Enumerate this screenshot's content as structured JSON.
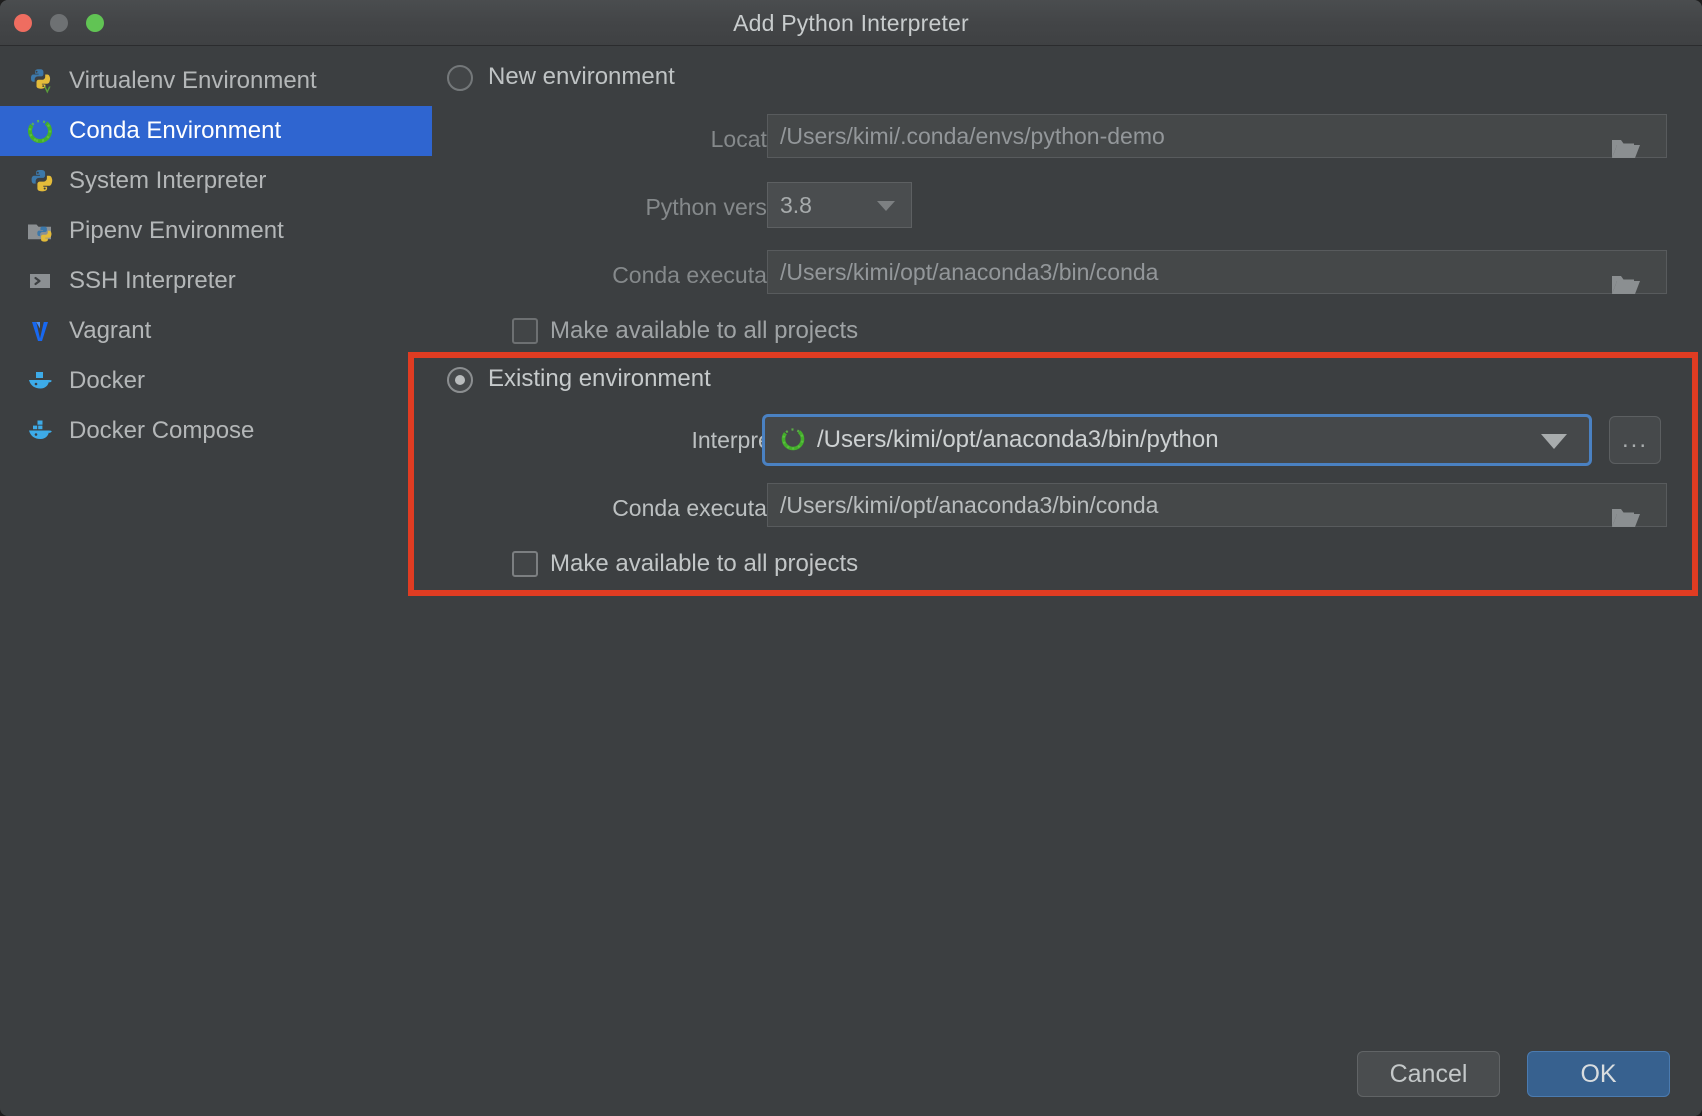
{
  "window": {
    "title": "Add Python Interpreter",
    "traffic_lights": [
      "close",
      "minimize",
      "maximize"
    ]
  },
  "sidebar": {
    "items": [
      {
        "label": "Virtualenv Environment",
        "icon": "python-virtualenv-icon",
        "selected": false
      },
      {
        "label": "Conda Environment",
        "icon": "conda-icon",
        "selected": true
      },
      {
        "label": "System Interpreter",
        "icon": "python-icon",
        "selected": false
      },
      {
        "label": "Pipenv Environment",
        "icon": "pipenv-icon",
        "selected": false
      },
      {
        "label": "SSH Interpreter",
        "icon": "ssh-terminal-icon",
        "selected": false
      },
      {
        "label": "Vagrant",
        "icon": "vagrant-icon",
        "selected": false
      },
      {
        "label": "Docker",
        "icon": "docker-icon",
        "selected": false
      },
      {
        "label": "Docker Compose",
        "icon": "docker-compose-icon",
        "selected": false
      }
    ]
  },
  "new_environment": {
    "radio_label": "New environment",
    "selected": false,
    "location": {
      "label": "Location:",
      "value": "/Users/kimi/.conda/envs/python-demo",
      "browse_icon": "folder-icon"
    },
    "python_version": {
      "label": "Python version:",
      "value": "3.8",
      "dropdown_icon": "chevron-down-icon"
    },
    "conda_executable": {
      "label": "Conda executable:",
      "value": "/Users/kimi/opt/anaconda3/bin/conda",
      "browse_icon": "folder-icon"
    },
    "make_available": {
      "label": "Make available to all projects",
      "checked": false
    }
  },
  "existing_environment": {
    "radio_label": "Existing environment",
    "selected": true,
    "interpreter": {
      "label": "Interpreter:",
      "value": "/Users/kimi/opt/anaconda3/bin/python",
      "item_icon": "conda-icon",
      "dropdown_icon": "chevron-down-icon",
      "more_button_label": "..."
    },
    "conda_executable": {
      "label": "Conda executable:",
      "value": "/Users/kimi/opt/anaconda3/bin/conda",
      "browse_icon": "folder-icon"
    },
    "make_available": {
      "label": "Make available to all projects",
      "checked": false
    }
  },
  "annotation": {
    "highlight_color": "#e03c22"
  },
  "footer": {
    "cancel_label": "Cancel",
    "ok_label": "OK"
  },
  "colors": {
    "window_bg": "#3c3f41",
    "titlebar_bg": "#434547",
    "selection_blue": "#2f65d0",
    "focus_blue": "#4a81c2",
    "ok_button_blue": "#37618f",
    "highlight_red": "#e03c22",
    "conda_green": "#43b02a"
  }
}
